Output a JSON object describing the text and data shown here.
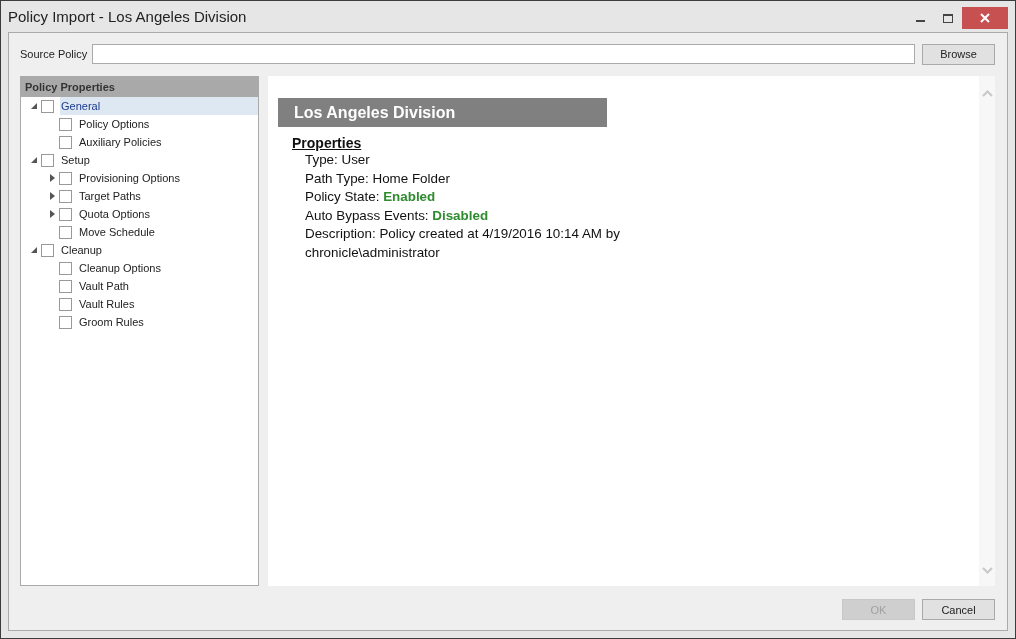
{
  "window": {
    "title": "Policy Import - Los Angeles Division"
  },
  "source_policy": {
    "label": "Source Policy",
    "browse": "Browse"
  },
  "tree": {
    "title": "Policy Properties",
    "items": [
      {
        "label": "General",
        "expanded": true,
        "checked": false,
        "selected": true,
        "children": [
          {
            "label": "Policy Options",
            "checked": false,
            "selected": false
          },
          {
            "label": "Auxiliary Policies",
            "checked": false,
            "selected": false
          }
        ]
      },
      {
        "label": "Setup",
        "expanded": true,
        "checked": false,
        "selected": false,
        "children": [
          {
            "label": "Provisioning Options",
            "expanded": false,
            "checked": false,
            "selected": false
          },
          {
            "label": "Target Paths",
            "expanded": false,
            "checked": false,
            "selected": false
          },
          {
            "label": "Quota Options",
            "expanded": false,
            "checked": false,
            "selected": false
          },
          {
            "label": "Move Schedule",
            "checked": false,
            "selected": false
          }
        ]
      },
      {
        "label": "Cleanup",
        "expanded": true,
        "checked": false,
        "selected": false,
        "children": [
          {
            "label": "Cleanup Options",
            "checked": false,
            "selected": false
          },
          {
            "label": "Vault Path",
            "checked": false,
            "selected": false
          },
          {
            "label": "Vault Rules",
            "checked": false,
            "selected": false
          },
          {
            "label": "Groom Rules",
            "checked": false,
            "selected": false
          }
        ]
      }
    ]
  },
  "details": {
    "heading": "Los Angeles Division",
    "section": "Properties",
    "lines": [
      "Type: User",
      "Path Type: Home Folder",
      "Policy State: **Enabled**",
      "Auto Bypass Events: **Disabled**",
      "Description: Policy created at 4/19/2016 10:14 AM by chronicle\\administrator"
    ]
  },
  "buttons": [
    {
      "label": "OK",
      "disabled": true
    },
    {
      "label": "Cancel",
      "disabled": false
    }
  ]
}
